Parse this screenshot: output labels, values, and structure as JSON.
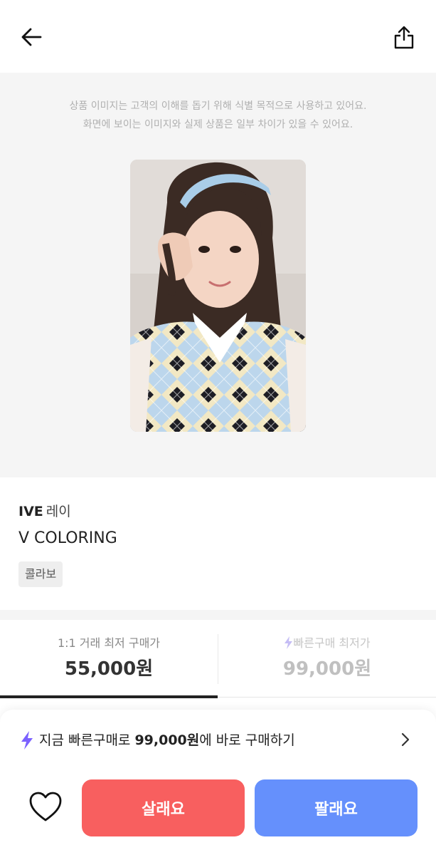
{
  "header": {
    "back_icon": "arrow-left-icon",
    "share_icon": "share-icon"
  },
  "image_notice": {
    "line1": "상품 이미지는 고객의 이해를 돕기 위해 식별 목적으로 사용하고 있어요.",
    "line2": "화면에 보이는 이미지와 실제 상품은 일부 차이가 있을 수 있어요."
  },
  "product": {
    "artist": "IVE",
    "member": "레이",
    "name": "V COLORING",
    "tag": "콜라보"
  },
  "price_tabs": [
    {
      "label": "1:1 거래 최저 구매가",
      "value": "55,000원",
      "active": true
    },
    {
      "label": "빠른구매 최저가",
      "value": "99,000원",
      "active": false,
      "icon": "lightning-icon"
    }
  ],
  "quick_buy": {
    "icon": "lightning-icon",
    "prefix": "지금 빠른구매로 ",
    "price": "99,000원",
    "suffix": "에 바로 구매하기"
  },
  "actions": {
    "like_icon": "heart-icon",
    "buy_label": "살래요",
    "sell_label": "팔래요"
  },
  "colors": {
    "buy": "#f85f5f",
    "sell": "#6590fc",
    "lightning": "#7b61ff",
    "lightning_muted": "#c5bdf5",
    "image_bg": "#f5f5f5"
  }
}
